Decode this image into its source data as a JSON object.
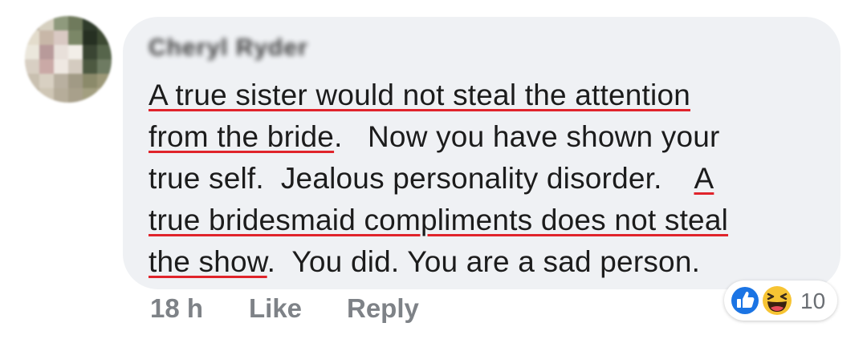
{
  "comment": {
    "author_name": "Cheryl Ryder",
    "lines": [
      [
        {
          "text": "A true sister would not steal the attention",
          "flag": true
        }
      ],
      [
        {
          "text": "from the bride",
          "flag": true
        },
        {
          "text": ".   Now you have shown your",
          "flag": false
        }
      ],
      [
        {
          "text": "true self.  Jealous personality disorder.    ",
          "flag": false
        },
        {
          "text": "A",
          "flag": true
        }
      ],
      [
        {
          "text": "true bridesmaid compliments does not steal",
          "flag": true
        }
      ],
      [
        {
          "text": "the show",
          "flag": true
        },
        {
          "text": ".  You did. You are a sad person.",
          "flag": false
        }
      ]
    ],
    "underline_color": "#e0242b"
  },
  "actions": {
    "time": "18 h",
    "like_label": "Like",
    "reply_label": "Reply"
  },
  "reactions": {
    "icons": [
      "like-reaction-icon",
      "haha-reaction-icon"
    ],
    "count": "10"
  },
  "colors": {
    "bubble": "#eff1f4",
    "action_text": "#7e8287",
    "like_blue": "#1b74e4",
    "haha_yellow": "#f7c433"
  }
}
